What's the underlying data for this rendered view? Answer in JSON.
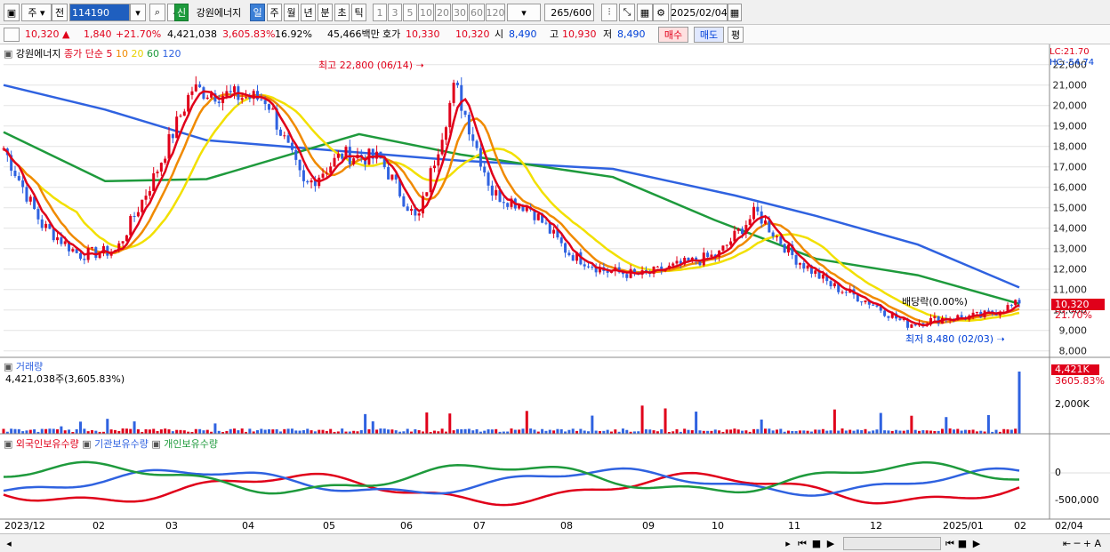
{
  "toolbar": {
    "market": "주",
    "prev_label": "전",
    "code": "114190",
    "credit_badge": "신",
    "stock_name": "강원에너지",
    "periods": [
      "일",
      "주",
      "월",
      "년",
      "분",
      "초",
      "틱"
    ],
    "active_period": "일",
    "intervals": [
      "1",
      "3",
      "5",
      "10",
      "20",
      "30",
      "60",
      "120"
    ],
    "count": "265",
    "count_total": "/600",
    "date": "2025/02/04"
  },
  "quote": {
    "price": "10,320 ▲",
    "change": "1,840",
    "change_pct": "+21.70%",
    "volume": "4,421,038",
    "volume_pct": "3,605.83%",
    "turnover": "16.92%",
    "amount": "45,466백만",
    "bid_label": "호가",
    "bid1": "10,330",
    "bid2": "10,320",
    "open_label": "시",
    "open": "8,490",
    "high_label": "고",
    "high": "10,930",
    "low_label": "저",
    "low": "8,490",
    "buy": "매수",
    "sell": "매도",
    "eval": "평"
  },
  "legend": {
    "stock": "강원에너지",
    "series_prefix": "종가 단순",
    "ma": [
      "5",
      "10",
      "20",
      "60",
      "120"
    ],
    "ma_colors": [
      "#e0001a",
      "#f08a00",
      "#f2e000",
      "#1e9a3c",
      "#2f62e0"
    ]
  },
  "annotations": {
    "high": "최고 22,800 (06/14)",
    "low": "최저 8,480 (02/03)",
    "dividend": "배당락(0.00%)",
    "lc": "LC:21.70",
    "hc": "HC:-54.74",
    "last_price": "10,320",
    "last_pct": "21.70%"
  },
  "volume_panel": {
    "title": "거래량",
    "value": "4,421,038주(3,605.83%)",
    "last": "4,421K",
    "last_pct": "3605.83%",
    "axis": [
      "2,000K"
    ]
  },
  "holding_panel": {
    "series": [
      "외국인보유수량",
      "기관보유수량",
      "개인보유수량"
    ],
    "colors": [
      "#e0001a",
      "#2f62e0",
      "#1e9a3c"
    ],
    "axis": [
      "0",
      "-500,000"
    ]
  },
  "x_axis": [
    "2023/12",
    "02",
    "03",
    "04",
    "05",
    "06",
    "07",
    "08",
    "09",
    "10",
    "11",
    "12",
    "2025/01",
    "02"
  ],
  "x_axis_right": "02/04",
  "y_axis": [
    "22,000",
    "21,000",
    "20,000",
    "19,000",
    "18,000",
    "17,000",
    "16,000",
    "15,000",
    "14,000",
    "13,000",
    "12,000",
    "11,000",
    "10,000",
    "9,000",
    "8,000"
  ],
  "chart_data": {
    "type": "line",
    "title": "강원에너지",
    "close_path": [
      [
        "2023/12",
        17900
      ],
      [
        "2024/01",
        14200
      ],
      [
        "2024/01m",
        12700
      ],
      [
        "2024/02",
        12900
      ],
      [
        "2024/02m",
        16500
      ],
      [
        "2024/03",
        20800
      ],
      [
        "2024/03m",
        20500
      ],
      [
        "2024/04",
        20300
      ],
      [
        "2024/04m",
        16000
      ],
      [
        "2024/05",
        17600
      ],
      [
        "2024/05m",
        17400
      ],
      [
        "2024/06",
        14300
      ],
      [
        "2024/06m",
        21000
      ],
      [
        "2024/07",
        15700
      ],
      [
        "2024/07m",
        15000
      ],
      [
        "2024/08",
        12800
      ],
      [
        "2024/08m",
        11900
      ],
      [
        "2024/09",
        11700
      ],
      [
        "2024/09m",
        12200
      ],
      [
        "2024/10",
        12700
      ],
      [
        "2024/10m",
        14800
      ],
      [
        "2024/11",
        12600
      ],
      [
        "2024/11m",
        11200
      ],
      [
        "2024/12",
        10400
      ],
      [
        "2024/12m",
        9300
      ],
      [
        "2025/01",
        9600
      ],
      [
        "2025/01m",
        9700
      ],
      [
        "2025/02",
        10320
      ]
    ],
    "ma120": [
      [
        0,
        21000
      ],
      [
        0.1,
        19800
      ],
      [
        0.2,
        18300
      ],
      [
        0.3,
        17900
      ],
      [
        0.45,
        17300
      ],
      [
        0.6,
        16900
      ],
      [
        0.72,
        15600
      ],
      [
        0.8,
        14600
      ],
      [
        0.9,
        13200
      ],
      [
        1.0,
        11100
      ]
    ],
    "ma60": [
      [
        0,
        18700
      ],
      [
        0.1,
        16300
      ],
      [
        0.2,
        16400
      ],
      [
        0.35,
        18600
      ],
      [
        0.45,
        17600
      ],
      [
        0.6,
        16500
      ],
      [
        0.7,
        14400
      ],
      [
        0.8,
        12500
      ],
      [
        0.9,
        11700
      ],
      [
        1.0,
        10300
      ]
    ],
    "ylim": [
      7900,
      22900
    ]
  }
}
